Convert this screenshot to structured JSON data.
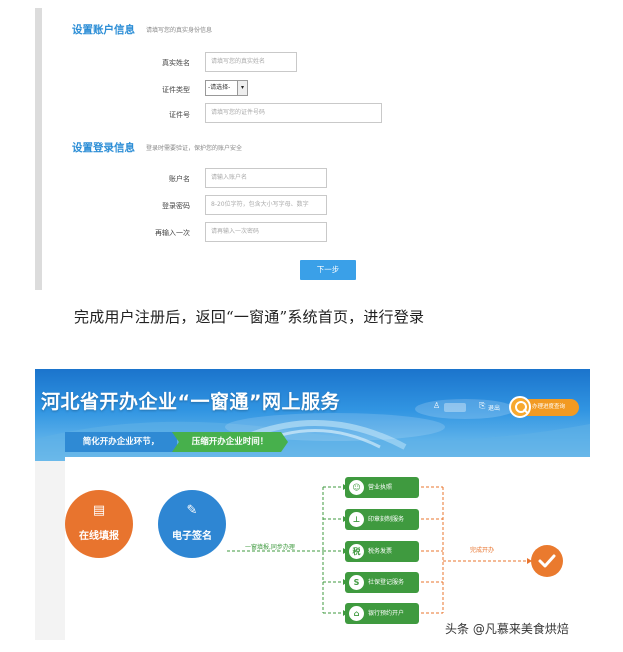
{
  "form": {
    "section1_title": "设置账户信息",
    "section1_hint": "请填写您的真实身份信息",
    "name_label": "真实姓名",
    "name_placeholder": "请填写您的真实姓名",
    "id_type_label": "证件类型",
    "id_type_value": "-请选择-",
    "id_number_label": "证件号",
    "id_number_placeholder": "请填写您的证件号码",
    "section2_title": "设置登录信息",
    "section2_hint": "登录时需要验证，保护您的账户安全",
    "username_label": "账户名",
    "username_placeholder": "请输入账户名",
    "password_label": "登录密码",
    "password_placeholder": "8-20位字符，包含大小写字母、数字",
    "confirm_label": "再输入一次",
    "confirm_placeholder": "请再输入一次密码",
    "next_button": "下一步"
  },
  "caption": "完成用户注册后，返回“一窗通”系统首页，进行登录",
  "portal": {
    "title": "河北省开办企业“一窗通”网上服务",
    "logout_label": "退出",
    "progress_button": "办理进度查询",
    "slogan_1": "简化开办企业环节，",
    "slogan_2": "压缩开办企业时间！",
    "step_fill": "在线填报",
    "step_sign": "电子签名",
    "sync_label": "一窗填报,同步办理",
    "services": [
      {
        "label": "营业执照",
        "icon": "license-icon"
      },
      {
        "label": "印章刻制服务",
        "icon": "seal-icon"
      },
      {
        "label": "税务发票",
        "icon": "tax-icon"
      },
      {
        "label": "社保登记服务",
        "icon": "social-security-icon"
      },
      {
        "label": "银行预约开户",
        "icon": "bank-icon"
      }
    ],
    "service_icon_glyphs": [
      "☺",
      "⊥",
      "税",
      "S",
      "⌂"
    ],
    "done_label": "完成开办"
  },
  "watermark": "头条 @凡慕来美食烘焙",
  "colors": {
    "accent_blue": "#2c8ed6",
    "button_blue": "#3aa0e8",
    "service_green": "#3f9a3f",
    "accent_orange": "#e8742e"
  }
}
